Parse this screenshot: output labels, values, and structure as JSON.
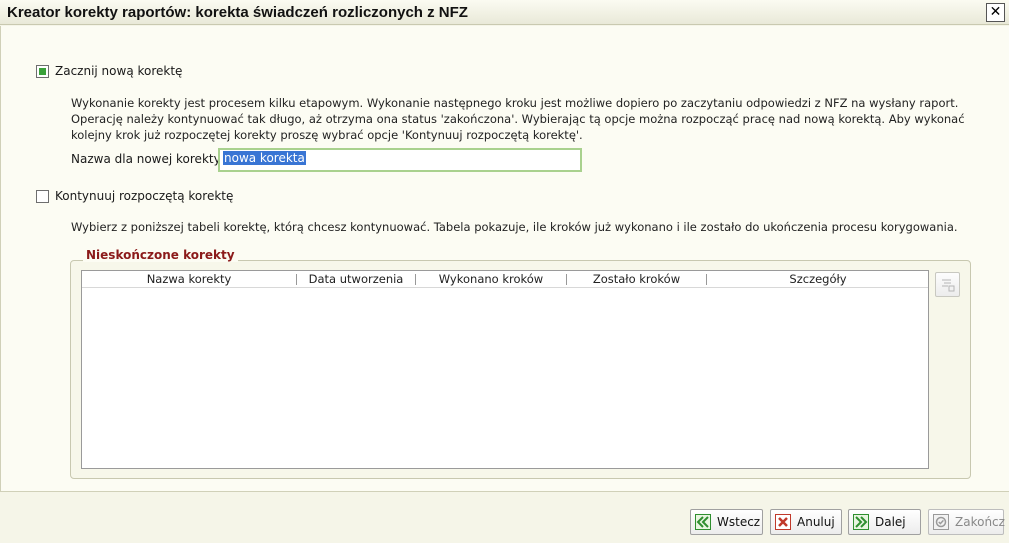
{
  "window": {
    "title": "Kreator korekty raportów: korekta świadczeń rozliczonych z NFZ",
    "close_icon": "close-icon"
  },
  "new_correction": {
    "checkbox_label": "Zacznij nową korektę",
    "checked": true,
    "description": "Wykonanie korekty jest procesem kilku etapowym. Wykonanie następnego kroku jest możliwe dopiero po zaczytaniu odpowiedzi z NFZ na wysłany raport. Operację należy kontynuować tak długo, aż otrzyma ona status 'zakończona'. Wybierając tą opcje można rozpocząć pracę nad nową korektą. Aby wykonać kolejny krok już rozpoczętej korekty proszę wybrać opcje 'Kontynuuj rozpoczętą korektę'.",
    "name_label": "Nazwa dla nowej korekty:",
    "name_value": "nowa korekta"
  },
  "continue_correction": {
    "checkbox_label": "Kontynuuj rozpoczętą korektę",
    "checked": false,
    "description": "Wybierz z poniższej tabeli korektę, którą chcesz kontynuować. Tabela pokazuje, ile kroków już wykonano i ile zostało do ukończenia procesu korygowania."
  },
  "unfinished": {
    "group_title": "Nieskończone korekty",
    "columns": [
      "Nazwa korekty",
      "Data utworzenia",
      "Wykonano kroków",
      "Zostało kroków",
      "Szczegóły"
    ],
    "rows": [],
    "side_button_icon": "details-list-icon"
  },
  "footer": {
    "back_label": "Wstecz",
    "cancel_label": "Anuluj",
    "next_label": "Dalej",
    "finish_label": "Zakończ"
  },
  "colors": {
    "group_title": "#8b1a1a",
    "checkbox_mark": "#3aa13a",
    "input_border": "#a9d18e",
    "selection": "#3975d4"
  }
}
